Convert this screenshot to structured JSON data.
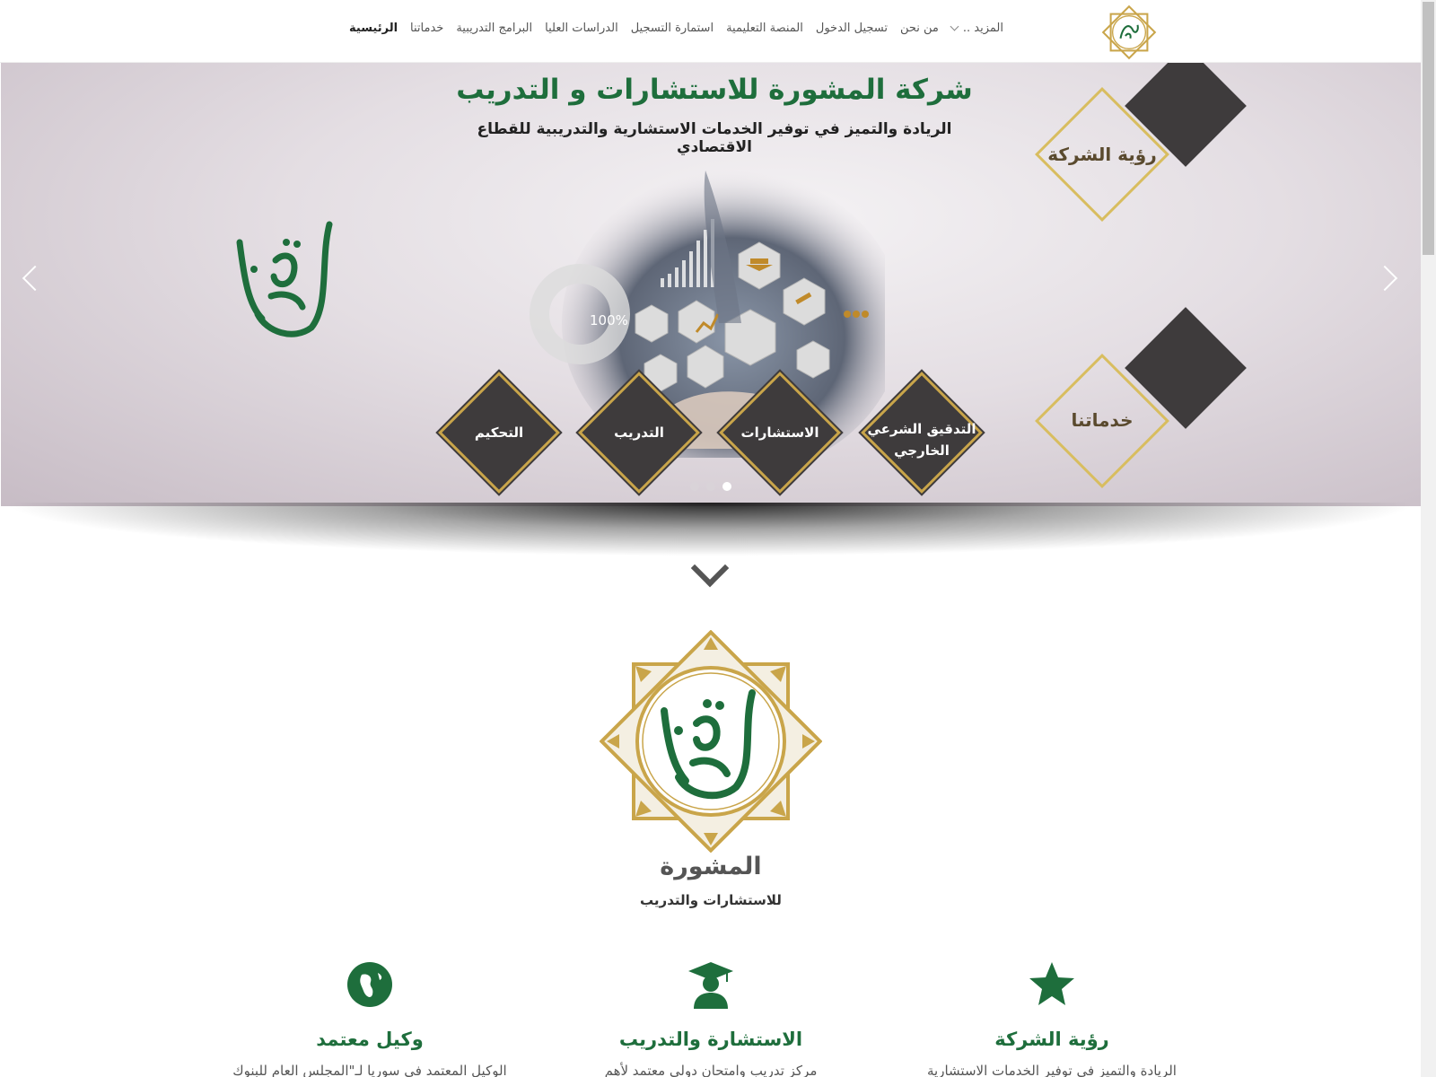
{
  "header": {
    "logo_alt": "المشورة",
    "nav": [
      {
        "label": "الرئيسية",
        "active": true
      },
      {
        "label": "خدماتنا"
      },
      {
        "label": "البرامج التدريبية"
      },
      {
        "label": "الدراسات العليا"
      },
      {
        "label": "استمارة التسجيل"
      },
      {
        "label": "المنصة التعليمية"
      },
      {
        "label": "تسجيل الدخول"
      },
      {
        "label": "من نحن"
      },
      {
        "label": "المزيد .."
      }
    ]
  },
  "slider": {
    "title": "شركة المشورة للاستشارات و التدريب",
    "subtitle": "الريادة والتميز في توفير الخدمات الاستشارية والتدريبية للقطاع الاقتصادي",
    "hero_percent": "100%",
    "side_diamonds": [
      "رؤية الشركة",
      "خدماتنا"
    ],
    "service_diamonds": [
      "التدقيق الشرعي الخارجي",
      "الاستشارات",
      "التدريب",
      "التحكيم"
    ],
    "slide_count": 3,
    "active_slide": 3
  },
  "brand": {
    "logo_text": "المشورة",
    "name": "المشورة",
    "tagline": "للاستشارات والتدريب"
  },
  "features": [
    {
      "icon": "globe-icon",
      "title": "وكيل معتمد",
      "text": "الوكيل المعتمد في سوريا لـ\"المجلس العام للبنوك"
    },
    {
      "icon": "graduate-icon",
      "title": "الاستشارة والتدريب",
      "text": "مركز تدريب وامتحان دولي معتمد لأهم"
    },
    {
      "icon": "star-icon",
      "title": "رؤية الشركة",
      "text": "الريادة والتميز في توفير الخدمات الاستشارية"
    }
  ],
  "colors": {
    "brand_green": "#1e6e3c",
    "gold": "#c9a54a",
    "diamond_dark": "#3e3b3c"
  }
}
